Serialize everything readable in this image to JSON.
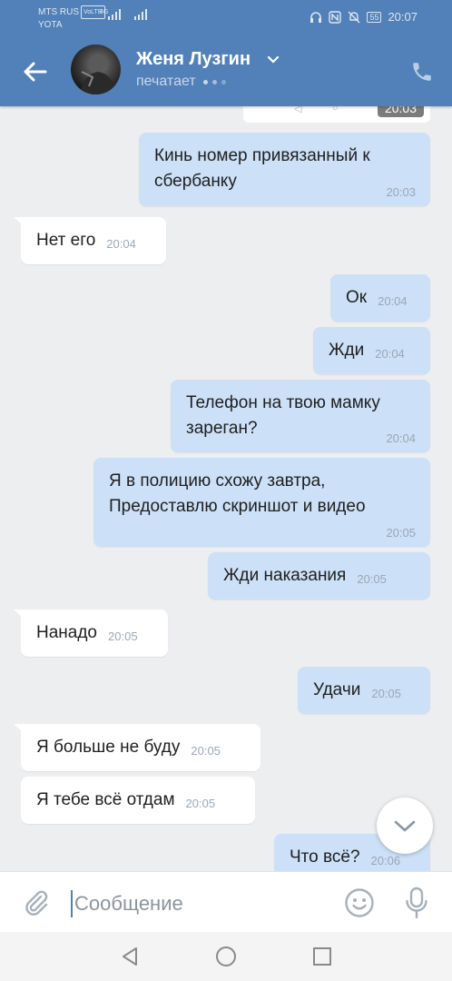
{
  "status_bar": {
    "carrier1": "MTS RUS",
    "volte": "VoLTE",
    "carrier2": "YOTA",
    "network": "4G",
    "battery": "55",
    "time": "20:07"
  },
  "header": {
    "contact_name": "Женя Лузгин",
    "status": "печатает",
    "previous_time": "20:03"
  },
  "messages": [
    {
      "dir": "out",
      "text": "Кинь номер привязанный к\nсбербанку",
      "time": "20:03"
    },
    {
      "dir": "in",
      "text": "Нет его",
      "time": "20:04"
    },
    {
      "dir": "out",
      "text": "Ок",
      "time": "20:04"
    },
    {
      "dir": "out",
      "text": "Жди",
      "time": "20:04"
    },
    {
      "dir": "out",
      "text": "Телефон на твою мамку\nзареган?",
      "time": "20:04"
    },
    {
      "dir": "out",
      "text": "Я в полицию схожу завтра,\nПредоставлю скриншот и видео",
      "time": "20:05"
    },
    {
      "dir": "out",
      "text": "Жди наказания",
      "time": "20:05"
    },
    {
      "dir": "in",
      "text": "Нанадо",
      "time": "20:05"
    },
    {
      "dir": "out",
      "text": "Удачи",
      "time": "20:05"
    },
    {
      "dir": "in",
      "text": "Я больше не буду",
      "time": "20:05"
    },
    {
      "dir": "in",
      "text": "Я тебе всё отдам",
      "time": "20:05"
    },
    {
      "dir": "out",
      "text": "Что всё?",
      "time": "20:06"
    }
  ],
  "composer": {
    "placeholder": "Сообщение"
  },
  "colors": {
    "header_bg": "#5181b8",
    "outgoing_bubble": "#cce0f7",
    "incoming_bubble": "#ffffff",
    "chat_bg": "#edeef0"
  },
  "icons": {
    "back": "back-arrow-icon",
    "call": "phone-icon",
    "attach": "paperclip-icon",
    "emoji": "smiley-icon",
    "mic": "microphone-icon",
    "scroll": "chevron-down-icon"
  }
}
